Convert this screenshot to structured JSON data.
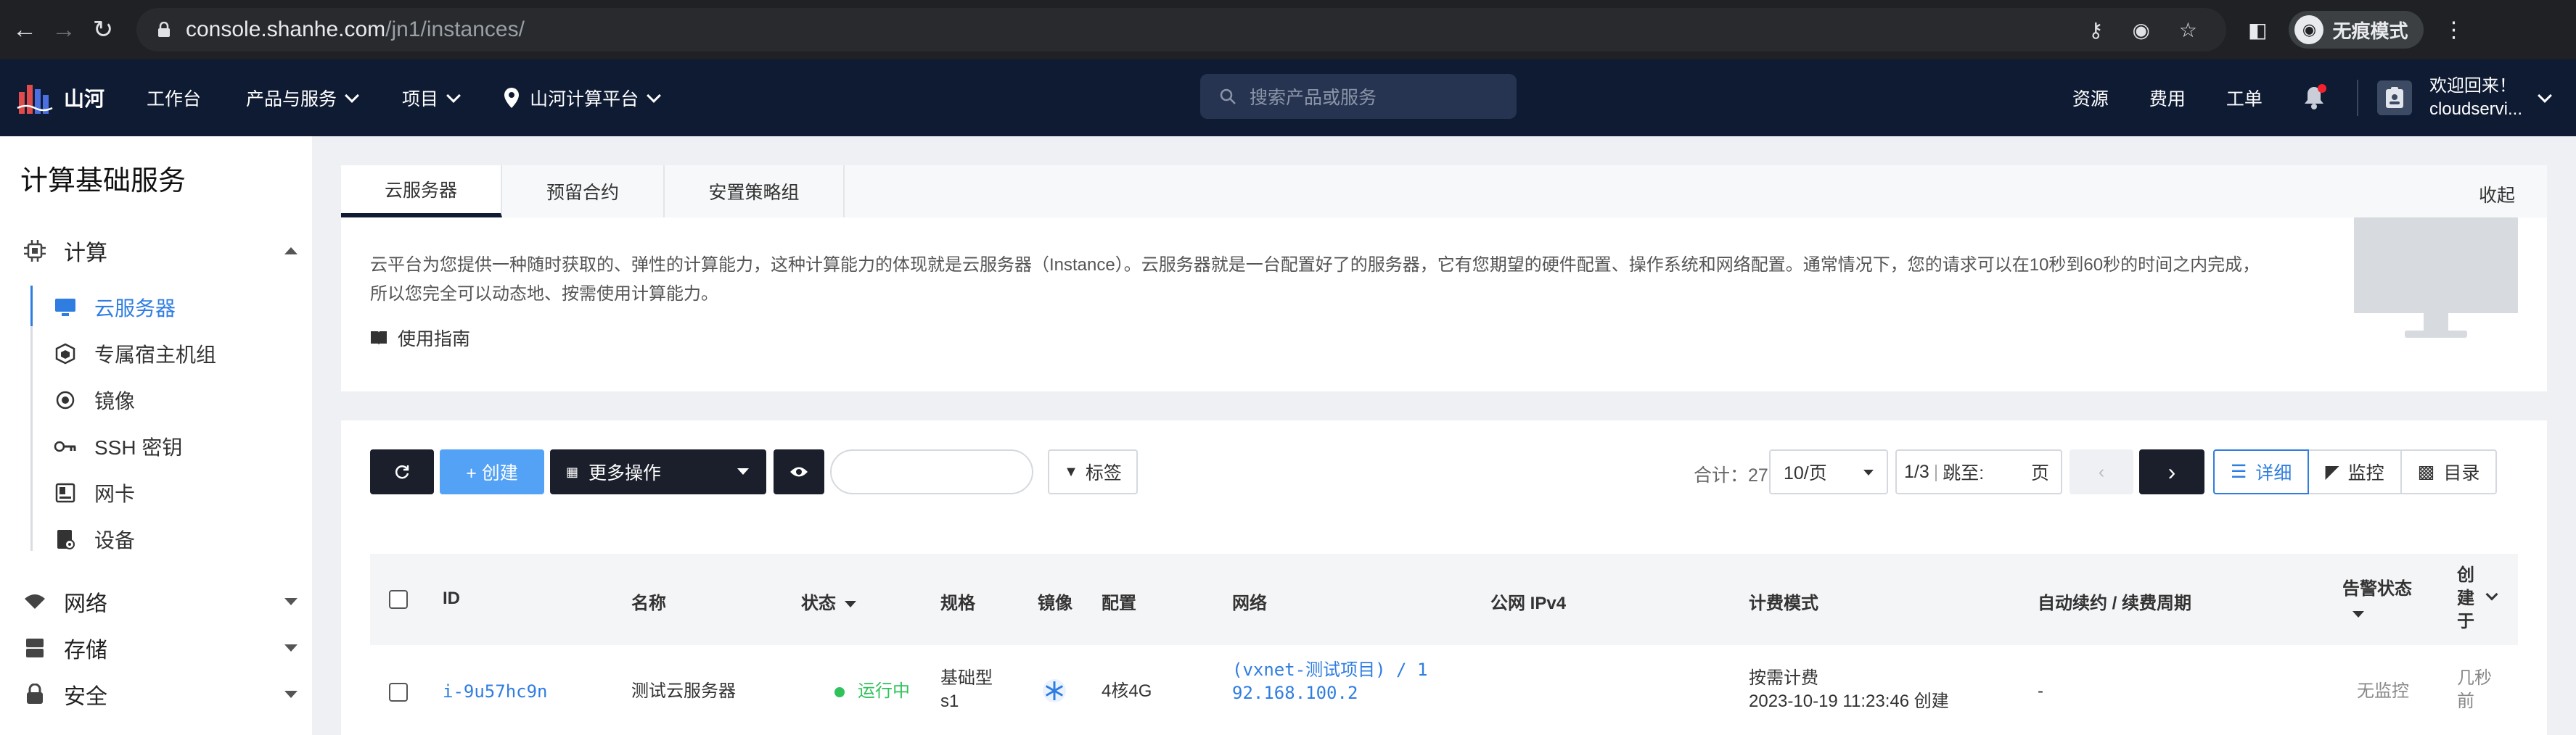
{
  "browser": {
    "url_host": "console.shanhe.com",
    "url_path": "/jn1/instances/",
    "profile_label": "无痕模式"
  },
  "header": {
    "logo_text": "山河",
    "nav": [
      "工作台",
      "产品与服务",
      "项目"
    ],
    "region": "山河计算平台",
    "search_placeholder": "搜索产品或服务",
    "right_links": [
      "资源",
      "费用",
      "工单"
    ],
    "welcome": "欢迎回来！",
    "username": "cloudservi..."
  },
  "sidebar": {
    "title": "计算基础服务",
    "group_compute": "计算",
    "items": [
      {
        "label": "云服务器",
        "icon": "monitor-icon"
      },
      {
        "label": "专属宿主机组",
        "icon": "cube-icon"
      },
      {
        "label": "镜像",
        "icon": "disc-icon"
      },
      {
        "label": "SSH 密钥",
        "icon": "key-icon"
      },
      {
        "label": "网卡",
        "icon": "nic-icon"
      },
      {
        "label": "设备",
        "icon": "device-icon"
      }
    ],
    "group_network": "网络",
    "group_storage": "存储",
    "group_security": "安全"
  },
  "info": {
    "tabs": [
      "云服务器",
      "预留合约",
      "安置策略组"
    ],
    "collapse": "收起",
    "description": "云平台为您提供一种随时获取的、弹性的计算能力，这种计算能力的体现就是云服务器（Instance）。云服务器就是一台配置好了的服务器，它有您期望的硬件配置、操作系统和网络配置。通常情况下，您的请求可以在10秒到60秒的时间之内完成，所以您完全可以动态地、按需使用计算能力。",
    "guide": "使用指南"
  },
  "toolbar": {
    "create": "+ 创建",
    "more_ops": "更多操作",
    "tags": "标签",
    "total": "合计：27",
    "page_size": "10/页",
    "page_info": "1/3",
    "jump_label": "跳至:",
    "page_unit": "页",
    "views": [
      "详细",
      "监控",
      "目录"
    ]
  },
  "table": {
    "headers": [
      "ID",
      "名称",
      "状态",
      "规格",
      "镜像",
      "配置",
      "网络",
      "公网 IPv4",
      "计费模式",
      "自动续约 / 续费周期",
      "告警状态",
      "创建于"
    ],
    "row": {
      "id": "i-9u57hc9n",
      "name": "测试云服务器",
      "status": "运行中",
      "spec_line1": "基础型",
      "spec_line2": "s1",
      "config": "4核4G",
      "network_line1": "(vxnet-测试项目) / 1",
      "network_line2": "92.168.100.2",
      "billing": "按需计费",
      "billing_time": "2023-10-19 11:23:46 创建",
      "renew": "-",
      "alarm": "无监控",
      "created": "几秒前"
    }
  },
  "colors": {
    "accent": "#2f7de1",
    "header_bg": "#0f1b33",
    "create_btn": "#53a2f5",
    "running": "#2fc25b"
  }
}
